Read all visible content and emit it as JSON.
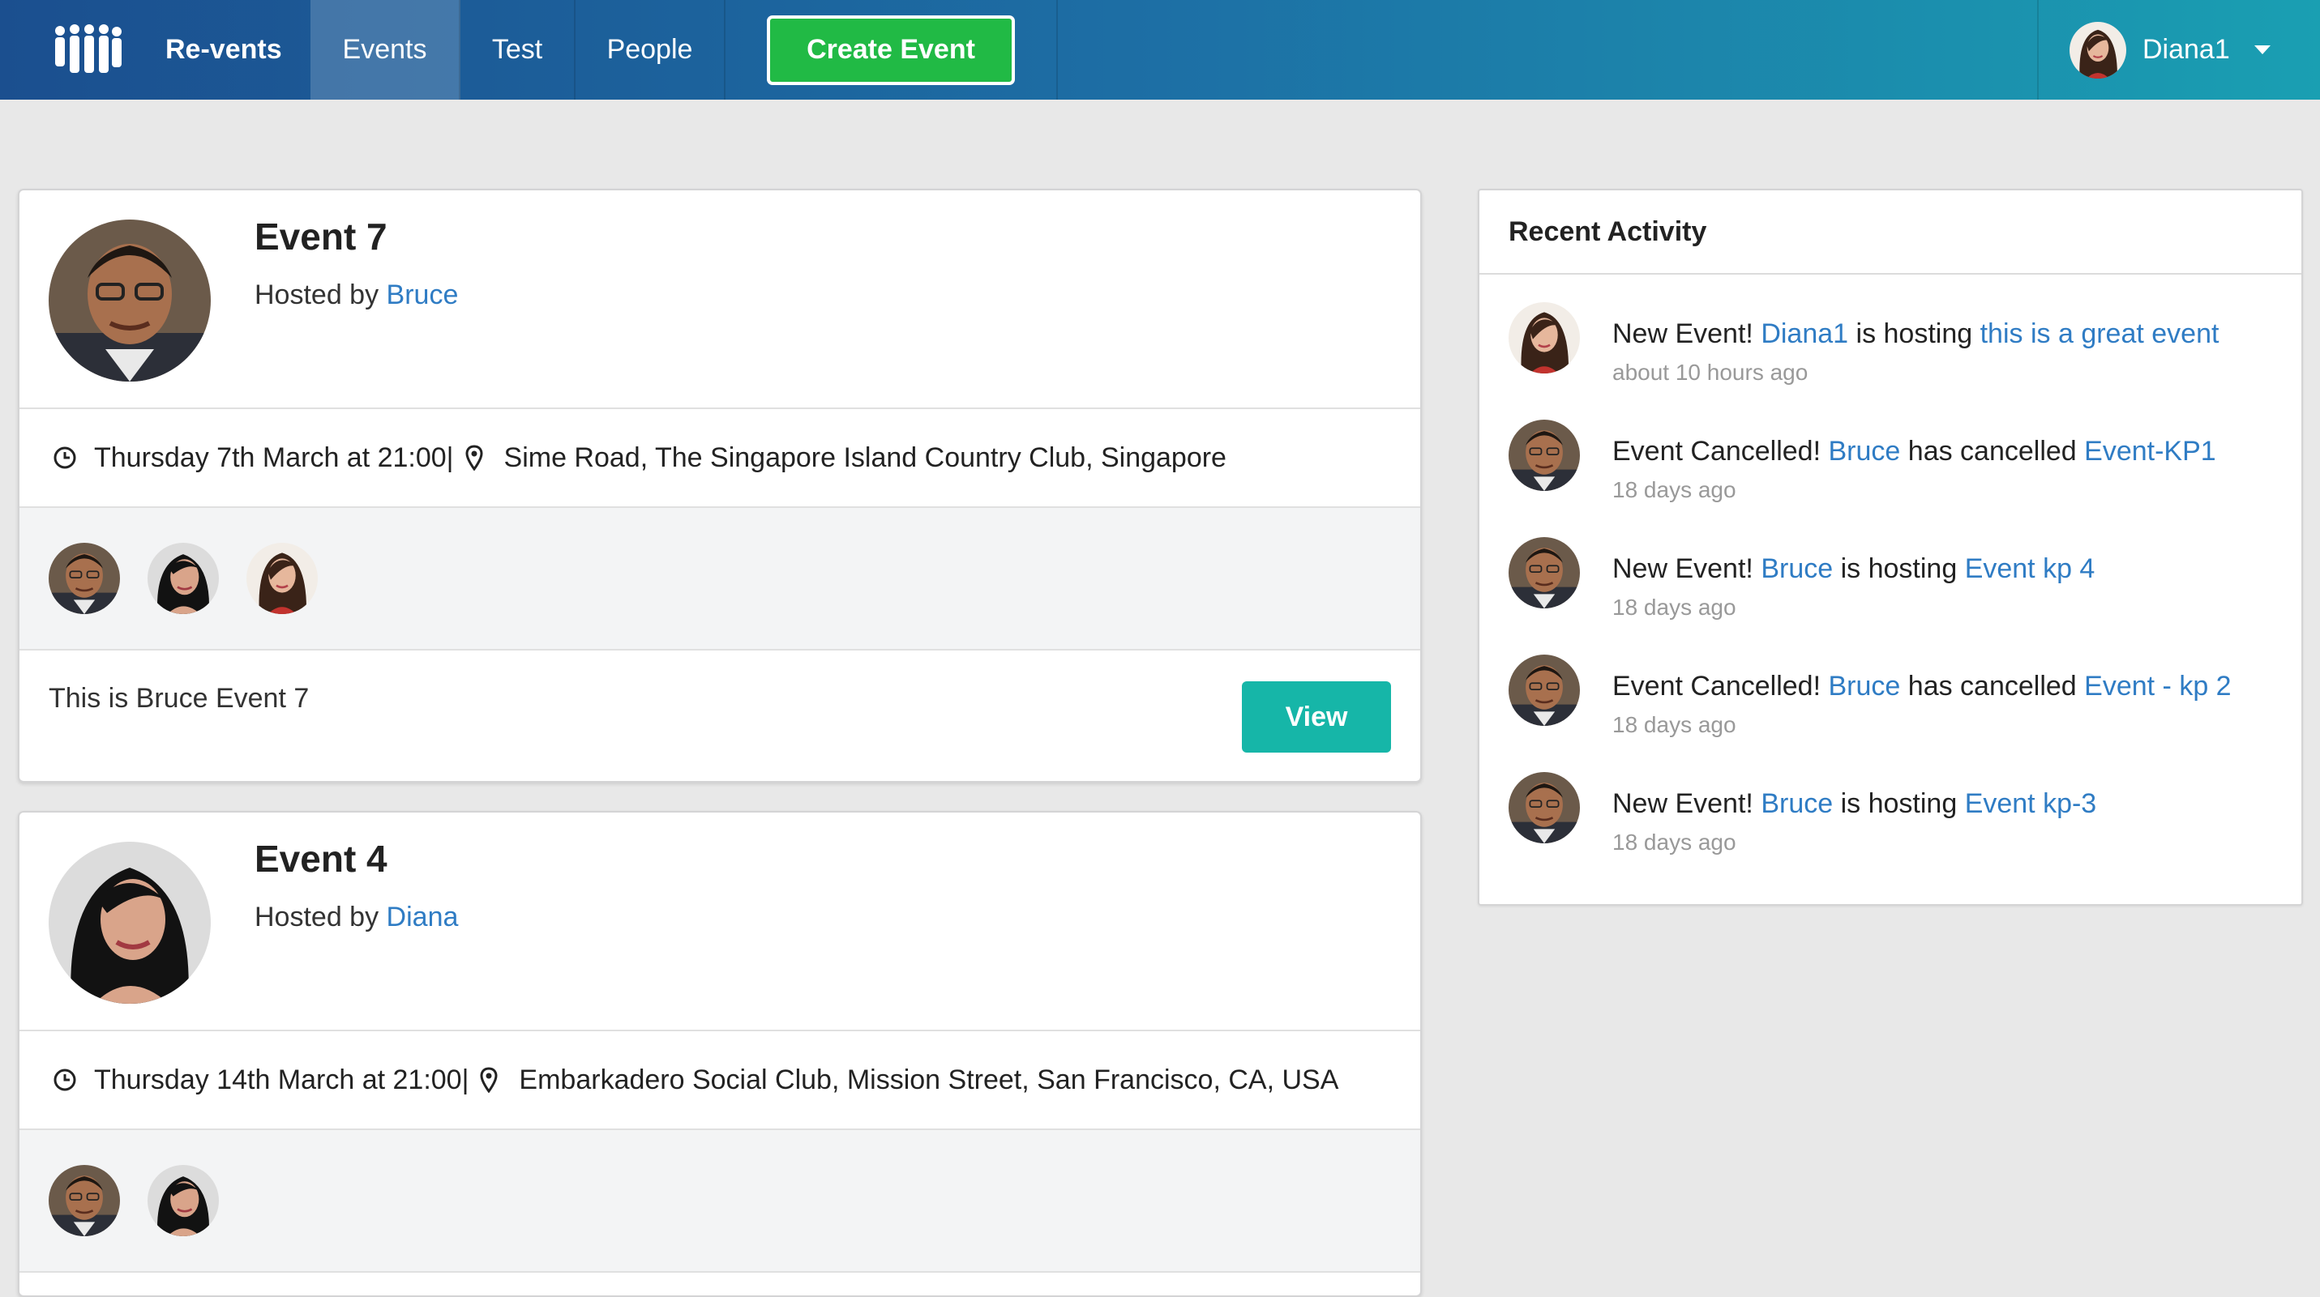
{
  "nav": {
    "brand": "Re-vents",
    "items": [
      "Events",
      "Test",
      "People"
    ],
    "create_label": "Create Event",
    "user_name": "Diana1"
  },
  "events": [
    {
      "title": "Event 7",
      "hosted_prefix": "Hosted by",
      "host": "Bruce",
      "date": "Thursday 7th March at 21:00|",
      "venue": "Sime Road, The Singapore Island Country Club, Singapore",
      "description": "This is Bruce Event 7",
      "view_label": "View",
      "attendees": [
        "Bruce",
        "Diana",
        "Diana1"
      ]
    },
    {
      "title": "Event 4",
      "hosted_prefix": "Hosted by",
      "host": "Diana",
      "date": "Thursday 14th March at 21:00|",
      "venue": "Embarkadero Social Club, Mission Street, San Francisco, CA, USA",
      "attendees": [
        "Bruce",
        "Diana"
      ]
    }
  ],
  "activity": {
    "title": "Recent Activity",
    "items": [
      {
        "action": "New Event!",
        "user": "Diana1",
        "verb": "is hosting",
        "event": "this is a great event",
        "time": "about 10 hours ago"
      },
      {
        "action": "Event Cancelled!",
        "user": "Bruce",
        "verb": "has cancelled",
        "event": "Event-KP1",
        "time": "18 days ago"
      },
      {
        "action": "New Event!",
        "user": "Bruce",
        "verb": "is hosting",
        "event": "Event kp 4",
        "time": "18 days ago"
      },
      {
        "action": "Event Cancelled!",
        "user": "Bruce",
        "verb": "has cancelled",
        "event": "Event - kp 2",
        "time": "18 days ago"
      },
      {
        "action": "New Event!",
        "user": "Bruce",
        "verb": "is hosting",
        "event": "Event kp-3",
        "time": "18 days ago"
      }
    ]
  },
  "colors": {
    "accent": "#2f7cc4",
    "create": "#21ba45",
    "view": "#16b6a8"
  }
}
